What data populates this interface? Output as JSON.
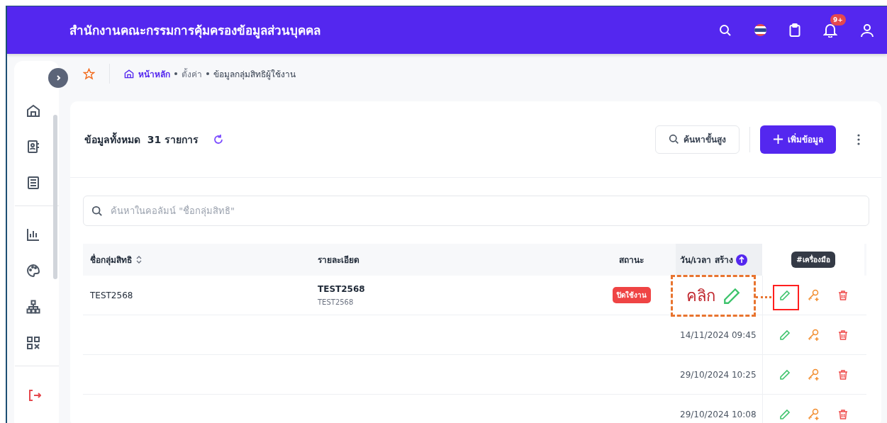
{
  "header": {
    "title": "สำนักงานคณะกรรมการคุ้มครองข้อมูลส่วนบุคคล",
    "notification_badge": "9+"
  },
  "breadcrumb": [
    {
      "label": "หน้าหลัก",
      "kind": "home"
    },
    {
      "label": "ตั้งค่า",
      "kind": "link"
    },
    {
      "label": "ข้อมูลกลุ่มสิทธิผู้ใช้งาน",
      "kind": "current"
    }
  ],
  "summary": {
    "label": "ข้อมูลทั้งหมด",
    "count": "31",
    "unit": "รายการ"
  },
  "buttons": {
    "advanced_search": "ค้นหาขั้นสูง",
    "add": "เพิ่มข้อมูล"
  },
  "search": {
    "placeholder": "ค้นหาในคอลัมน์ \"ชื่อกลุ่มสิทธิ\""
  },
  "table": {
    "columns": [
      {
        "label": "ชื่อกลุ่มสิทธิ",
        "kind": "sortable"
      },
      {
        "label": "รายละเอียด",
        "kind": "plain"
      },
      {
        "label": "สถานะ",
        "kind": "plain"
      },
      {
        "label": "วัน/เวลา สร้าง",
        "kind": "sorted"
      }
    ],
    "tools_tooltip": "#เครื่องมือ",
    "rows": [
      {
        "name": "TEST2568",
        "detail": "TEST2568",
        "detail_sub": "TEST2568",
        "status": {
          "label": "ปิดใช้งาน",
          "active": false
        }
      },
      {
        "created": "14/11/2024 09:45"
      },
      {
        "created": "29/10/2024 10:25"
      },
      {
        "created": "29/10/2024 10:08"
      }
    ]
  },
  "annotation": {
    "label": "คลิก"
  }
}
